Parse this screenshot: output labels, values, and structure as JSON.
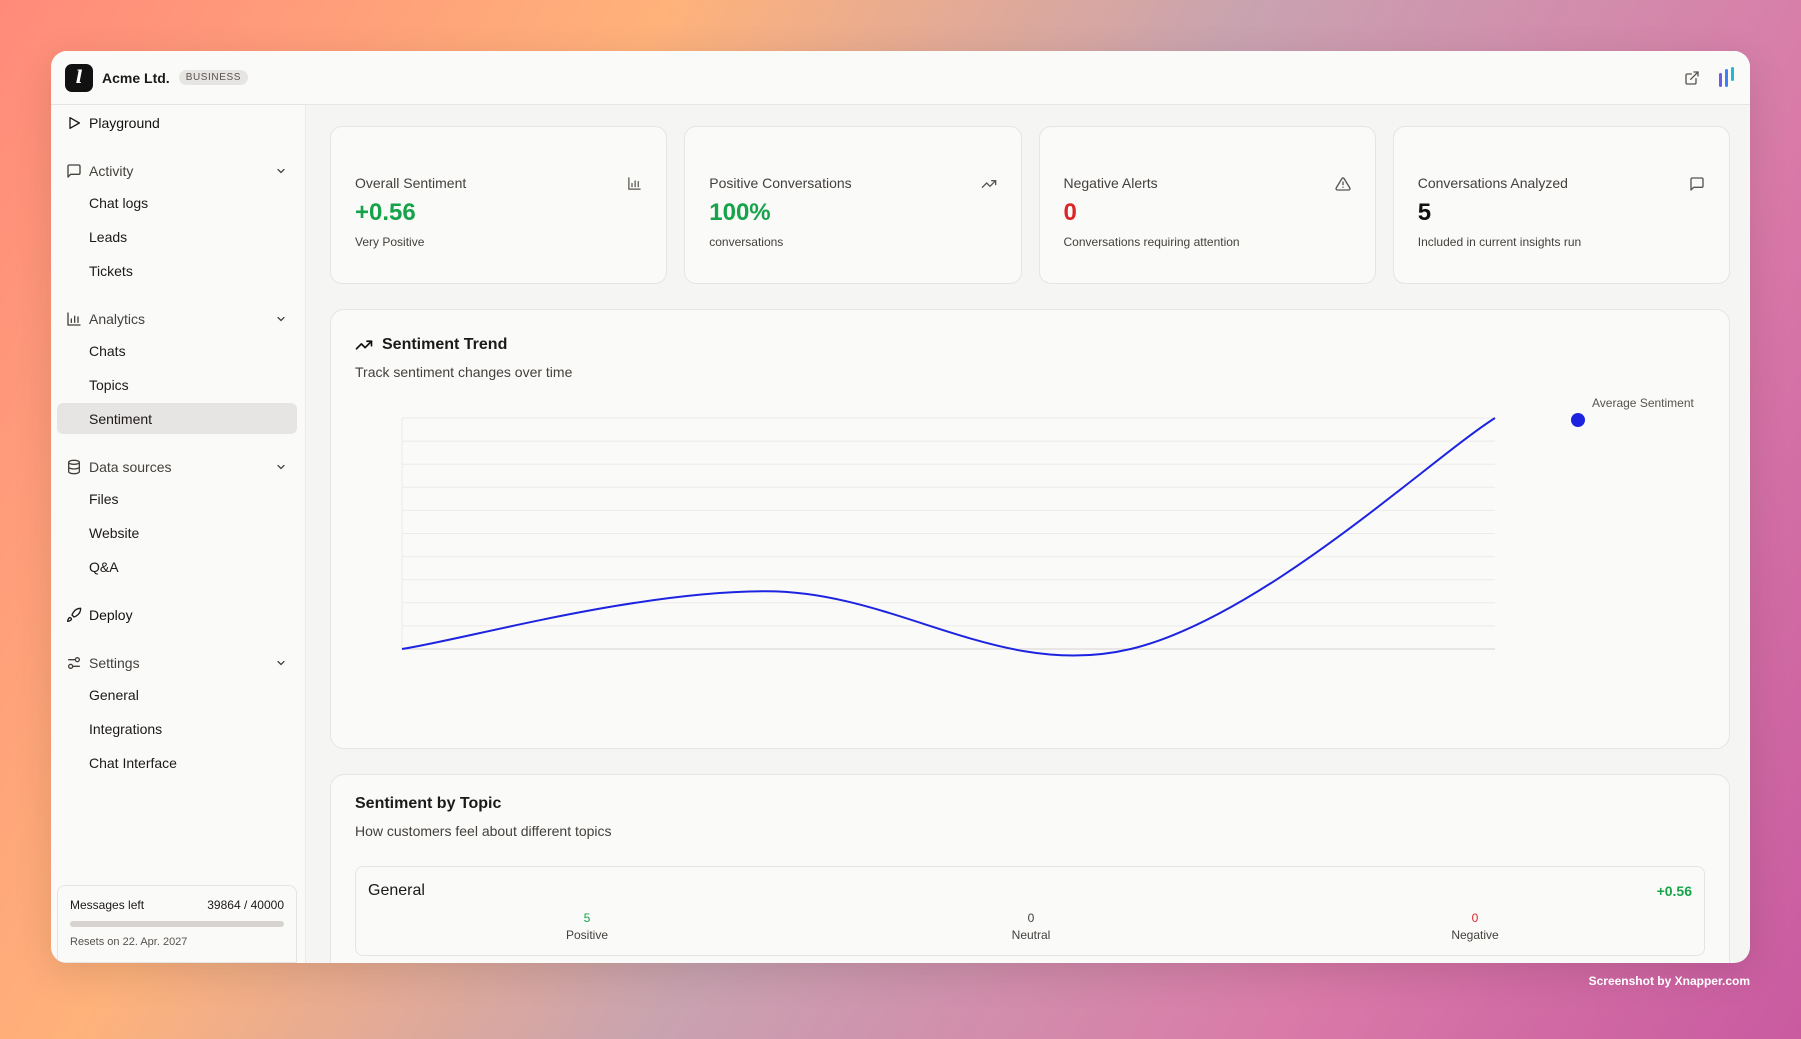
{
  "header": {
    "org_name": "Acme Ltd.",
    "plan_badge": "BUSINESS",
    "logo_letter": "l"
  },
  "sidebar": {
    "playground": "Playground",
    "activity": {
      "label": "Activity",
      "items": [
        "Chat logs",
        "Leads",
        "Tickets"
      ]
    },
    "analytics": {
      "label": "Analytics",
      "items": [
        "Chats",
        "Topics",
        "Sentiment"
      ],
      "active": "Sentiment"
    },
    "data_sources": {
      "label": "Data sources",
      "items": [
        "Files",
        "Website",
        "Q&A"
      ]
    },
    "deploy": "Deploy",
    "settings": {
      "label": "Settings",
      "items": [
        "General",
        "Integrations",
        "Chat Interface"
      ]
    }
  },
  "quota": {
    "label": "Messages left",
    "value": "39864 / 40000",
    "used_fraction": 0.0034,
    "reset_text": "Resets on 22. Apr. 2027"
  },
  "stats": [
    {
      "label": "Overall Sentiment",
      "value": "+0.56",
      "sub": "Very Positive",
      "icon": "bar-chart-icon",
      "tone": "green"
    },
    {
      "label": "Positive Conversations",
      "value": "100%",
      "sub": "conversations",
      "icon": "trending-up-icon",
      "tone": "green"
    },
    {
      "label": "Negative Alerts",
      "value": "0",
      "sub": "Conversations requiring attention",
      "icon": "alert-triangle-icon",
      "tone": "red"
    },
    {
      "label": "Conversations Analyzed",
      "value": "5",
      "sub": "Included in current insights run",
      "icon": "message-square-icon",
      "tone": "dark"
    }
  ],
  "trend_card": {
    "title": "Sentiment Trend",
    "subtitle": "Track sentiment changes over time"
  },
  "chart_data": {
    "type": "line",
    "title": "Sentiment Trend",
    "xlabel": "",
    "ylabel": "",
    "grid": true,
    "legend": "top-right",
    "series": [
      {
        "name": "Average Sentiment",
        "color": "#1d24e0",
        "values": [
          0,
          0.25,
          0,
          1
        ]
      }
    ],
    "ylim": [
      0,
      1
    ]
  },
  "topics_card": {
    "title": "Sentiment by Topic",
    "subtitle": "How customers feel about different topics",
    "topics": [
      {
        "name": "General",
        "score": "+0.56",
        "positive": "5",
        "neutral": "0",
        "negative": "0",
        "labels": {
          "positive": "Positive",
          "neutral": "Neutral",
          "negative": "Negative"
        }
      }
    ]
  },
  "credit": "Screenshot by Xnapper.com",
  "colors": {
    "green": "#16a34a",
    "red": "#dc2626",
    "line": "#1d24e0"
  }
}
